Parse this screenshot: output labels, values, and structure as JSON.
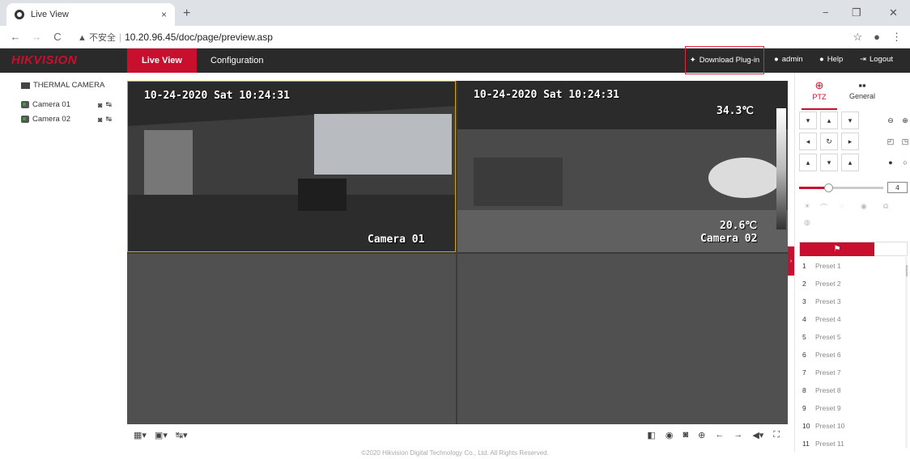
{
  "browser": {
    "tab_title": "Live View",
    "tab_close": "×",
    "new_tab": "+",
    "window_minimize": "−",
    "window_restore": "❐",
    "window_close": "✕",
    "url_warning": "▲ 不安全",
    "url": "10.20.96.45/doc/page/preview.asp"
  },
  "header": {
    "logo": "HIKVISION",
    "nav": {
      "live_view": "Live View",
      "configuration": "Configuration"
    },
    "download_plugin": "Download Plug-in",
    "user": "admin",
    "help": "Help",
    "logout": "Logout"
  },
  "device_tree": {
    "root": "THERMAL CAMERA",
    "cameras": [
      "Camera 01",
      "Camera 02"
    ]
  },
  "views": [
    {
      "timestamp": "10-24-2020 Sat 10:24:31",
      "name": "Camera 01"
    },
    {
      "timestamp": "10-24-2020 Sat 10:24:31",
      "name": "Camera 02",
      "temp_max": "34.3℃",
      "temp_min": "20.6℃"
    }
  ],
  "ptz": {
    "tab_ptz": "PTZ",
    "tab_general": "General",
    "speed": "4",
    "speed_level": 0.35,
    "presets": [
      "Preset 1",
      "Preset 2",
      "Preset 3",
      "Preset 4",
      "Preset 5",
      "Preset 6",
      "Preset 7",
      "Preset 8",
      "Preset 9",
      "Preset 10",
      "Preset 11"
    ]
  },
  "footer": "©2020 Hikvision Digital Technology Co., Ltd. All Rights Reserved.",
  "colors": {
    "brand": "#c8102e",
    "nav_bg": "#2a2a2a",
    "view_bg": "#505050"
  }
}
